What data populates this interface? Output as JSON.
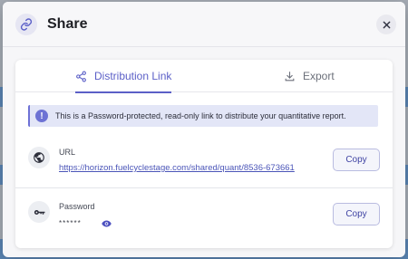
{
  "modal": {
    "title": "Share",
    "header_icon": "link-icon",
    "close_icon": "close-icon"
  },
  "tabs": [
    {
      "label": "Distribution Link",
      "icon": "share-icon",
      "active": true
    },
    {
      "label": "Export",
      "icon": "download-icon",
      "active": false
    }
  ],
  "banner": {
    "icon": "info-icon",
    "icon_glyph": "!",
    "text": "This is a Password-protected, read-only link to distribute your quantitative report."
  },
  "url_row": {
    "icon": "globe-icon",
    "label": "URL",
    "value": "https://horizon.fuelcyclestage.com/shared/quant/8536-673661",
    "copy_label": "Copy"
  },
  "password_row": {
    "icon": "key-icon",
    "label": "Password",
    "value": "******",
    "reveal_icon": "eye-icon",
    "copy_label": "Copy"
  },
  "colors": {
    "accent": "#5b5fc7",
    "banner_bg": "#e3e6f7",
    "link": "#4b55b8"
  }
}
